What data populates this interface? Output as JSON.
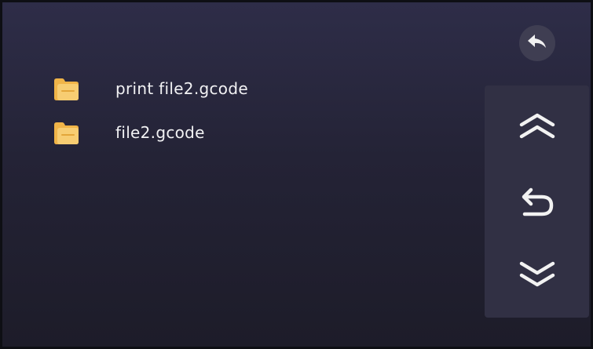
{
  "files": [
    {
      "name": "print file2.gcode",
      "icon": "folder-icon"
    },
    {
      "name": "file2.gcode",
      "icon": "folder-icon"
    }
  ],
  "controls": {
    "back": {
      "icon": "back-arrow-icon"
    },
    "page_up": {
      "icon": "double-chevron-up-icon"
    },
    "return": {
      "icon": "return-arrow-icon"
    },
    "page_down": {
      "icon": "double-chevron-down-icon"
    }
  },
  "colors": {
    "background_top": "#2e2d48",
    "background_bottom": "#1d1c29",
    "panel": "#313044",
    "folder": "#f5c35a",
    "icon": "#f2f2f2",
    "text": "#f2f2f4"
  }
}
